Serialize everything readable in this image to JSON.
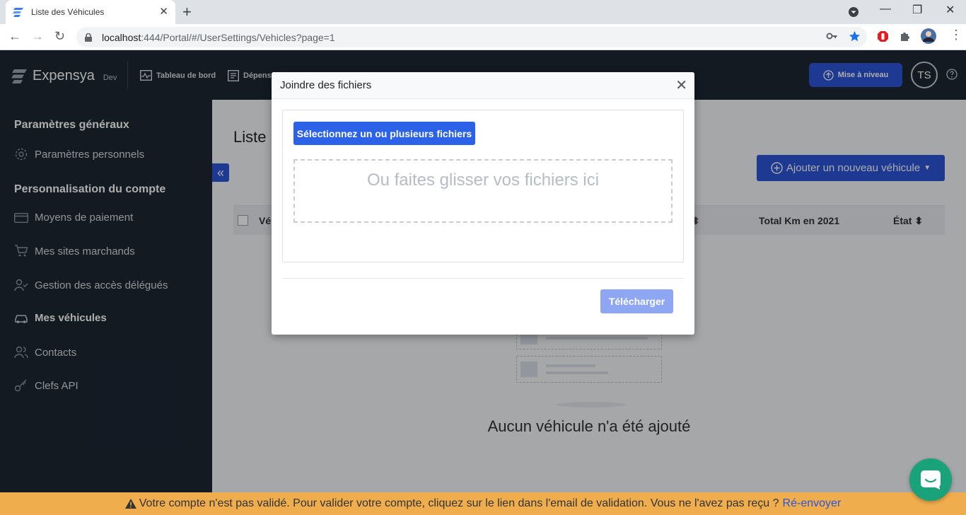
{
  "browser": {
    "tab_title": "Liste des Véhicules",
    "url_host": "localhost",
    "url_rest": ":444/Portal/#/UserSettings/Vehicles?page=1"
  },
  "header": {
    "logo_text": "Expensya",
    "env_label": "Dev",
    "nav": [
      "Tableau de bord",
      "Dépens"
    ],
    "upgrade_label": "Mise à niveau",
    "avatar_initials": "TS"
  },
  "sidebar": {
    "section1": "Paramètres généraux",
    "section2": "Personnalisation du compte",
    "items": [
      {
        "label": "Paramètres personnels",
        "icon": "gear-icon"
      },
      {
        "label": "Moyens de paiement",
        "icon": "credit-card-icon"
      },
      {
        "label": "Mes sites marchands",
        "icon": "cart-icon"
      },
      {
        "label": "Gestion des accès délégués",
        "icon": "user-check-icon"
      },
      {
        "label": "Mes véhicules",
        "icon": "car-icon"
      },
      {
        "label": "Contacts",
        "icon": "users-icon"
      },
      {
        "label": "Clefs API",
        "icon": "key-icon"
      }
    ]
  },
  "main": {
    "page_title": "Liste",
    "add_button": "Ajouter un nouveau véhicule",
    "columns": [
      "Vé",
      "Total Km en 2021",
      "État"
    ],
    "empty_text": "Aucun véhicule n'a été ajouté"
  },
  "modal": {
    "title": "Joindre des fichiers",
    "select_button": "Sélectionnez un ou plusieurs fichiers",
    "drop_text": "Ou faites glisser vos fichiers ici",
    "upload_button": "Télécharger"
  },
  "banner": {
    "text": "Votre compte n'est pas validé. Pour valider votre compte, cliquez sur le lien dans l'email de validation. Vous ne l'avez pas reçu ?",
    "link": "Ré-envoyer"
  },
  "colors": {
    "primary": "#2b55d6",
    "header_bg": "#1d2733",
    "banner_bg": "#f0ad4e",
    "chat_bg": "#1aa37a"
  }
}
